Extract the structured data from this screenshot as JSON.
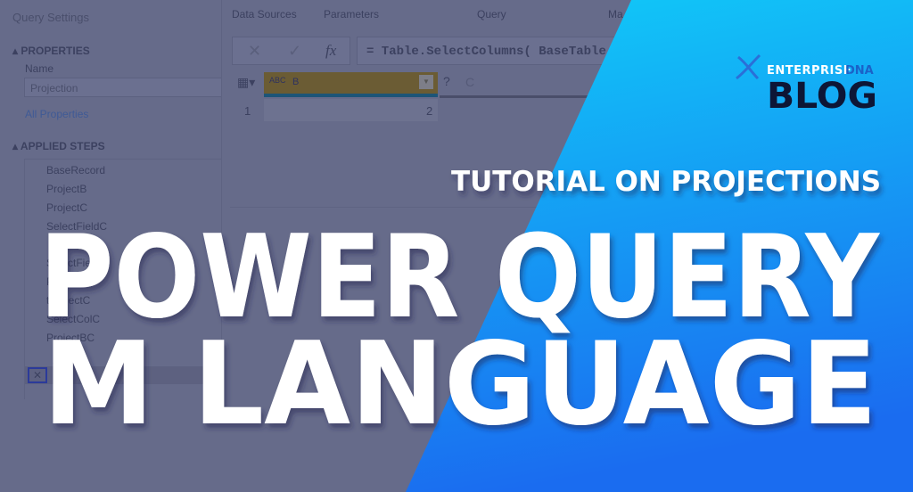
{
  "query_settings": {
    "title": "Query Settings",
    "properties_heading": "PROPERTIES",
    "name_label": "Name",
    "name_value": "Projection",
    "all_properties_link": "All Properties",
    "applied_steps_heading": "APPLIED STEPS",
    "steps": [
      "BaseRecord",
      "ProjectB",
      "ProjectC",
      "SelectFieldC",
      "SelectFieldB",
      "ProjectB",
      "tProjectC",
      "SelectColC",
      "ProjectBC",
      "Projection"
    ]
  },
  "ribbon_tabs": [
    "Data Sources",
    "Parameters",
    "Query",
    "Ma"
  ],
  "formula_bar": {
    "cancel": "✕",
    "commit": "✓",
    "fx": "fx",
    "formula": "= Table.SelectColumns( BaseTable,"
  },
  "grid": {
    "columns": [
      {
        "name": "B",
        "type": "ABC"
      },
      {
        "name": "C",
        "type": "?"
      }
    ],
    "rows": [
      {
        "index": "1",
        "B": "2",
        "C": ""
      }
    ]
  },
  "brand": {
    "name_a": "ENTERPRISE",
    "name_b": "DNA",
    "blog": "BLOG"
  },
  "headline": {
    "kicker": "TUTORIAL ON PROJECTIONS",
    "line1": "POWER QUERY",
    "line2": "M LANGUAGE"
  },
  "colors": {
    "gradient_top": "#10ccf8",
    "gradient_bottom": "#1a6cf0",
    "overlay": "#666b8a",
    "brand_dark": "#0d1636",
    "highlight_col": "#6b5c34"
  }
}
